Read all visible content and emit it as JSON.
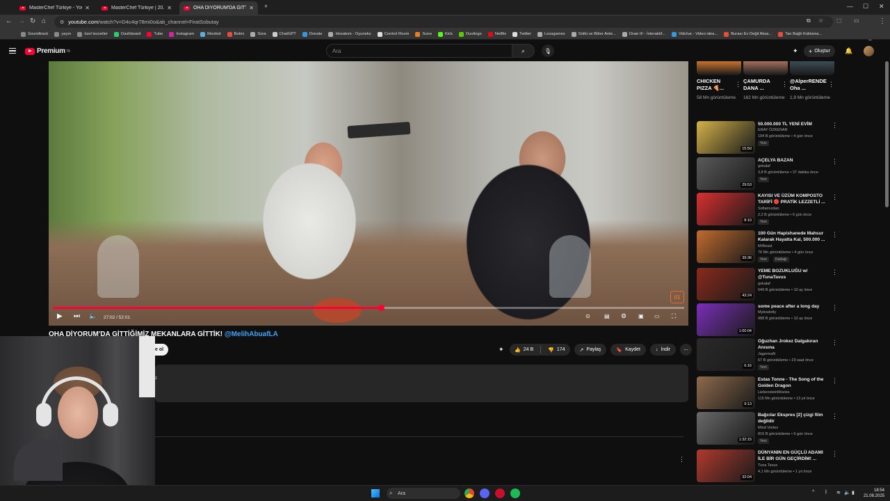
{
  "browser": {
    "tabs": [
      {
        "title": "MasterChef Türkiye - YouTube",
        "active": false
      },
      {
        "title": "MasterChef Türkiye | 20.07.2025",
        "active": false
      },
      {
        "title": "OHA DİYORUM'DA GİTTİĞİMİZ",
        "active": true
      }
    ],
    "url_host": "youtube.com",
    "url_path": "/watch?v=D4c4qr78mi0o&ab_channel=FiratSobutay",
    "bookmarks": [
      {
        "label": "Soundtrack",
        "color": "#888888"
      },
      {
        "label": "yayın",
        "color": "#888888"
      },
      {
        "label": "özel lezzetler",
        "color": "#888888"
      },
      {
        "label": "Dashboard",
        "color": "#2ecc71"
      },
      {
        "label": "Tube",
        "color": "#ff0033"
      },
      {
        "label": "Instagram",
        "color": "#d6249f"
      },
      {
        "label": "Moobot",
        "color": "#5ab0d6"
      },
      {
        "label": "Botrix",
        "color": "#e74c3c"
      },
      {
        "label": "Sora",
        "color": "#aaaaaa"
      },
      {
        "label": "ChatGPT",
        "color": "#cccccc"
      },
      {
        "label": "Donate",
        "color": "#3498db"
      },
      {
        "label": "Hesabım - Oyuneks",
        "color": "#aaaaaa"
      },
      {
        "label": "Control Room",
        "color": "#dddddd"
      },
      {
        "label": "Suno",
        "color": "#e67e22"
      },
      {
        "label": "Kick",
        "color": "#53fc18"
      },
      {
        "label": "Duolingo",
        "color": "#58cc02"
      },
      {
        "label": "Netflix",
        "color": "#e50914"
      },
      {
        "label": "Twitter",
        "color": "#dddddd"
      },
      {
        "label": "Lessgames",
        "color": "#aaaaaa"
      },
      {
        "label": "Sütlü ve Bitter Ante...",
        "color": "#aaaaaa"
      },
      {
        "label": "Draw It! - İnteraktif...",
        "color": "#aaaaaa"
      },
      {
        "label": "Vidclue - Video idea...",
        "color": "#3498db"
      },
      {
        "label": "Burası Ev Değil Aksa...",
        "color": "#e74c3c"
      },
      {
        "label": "Tan Bağlı Koklama...",
        "color": "#e74c3c"
      }
    ]
  },
  "header": {
    "brand": "Premium",
    "brand_sup": "TR",
    "search_placeholder": "Ara",
    "create_label": "Oluştur"
  },
  "player": {
    "time_label": "27:02 / 52:01",
    "progress_fraction": 0.52,
    "channel_logo": "01"
  },
  "video": {
    "title": "OHA DİYORUM'DA GİTTİĞİMİZ MEKANLARA GİTTİK!",
    "mention": "@MelihAbuafLA",
    "subscribe_fragment": "e ol",
    "like_count": "24 B",
    "dislike_count": "174",
    "share_label": "Paylaş",
    "save_label": "Kaydet",
    "download_label": "İndir",
    "desc_fragment": "z"
  },
  "shorts": [
    {
      "title": "CHICKEN PIZZA 🍕...",
      "views": "58 Mn görüntüleme",
      "color": "#c9742f"
    },
    {
      "title": "ÇAMURDA DANA ...",
      "views": "162 Mn görüntüleme",
      "color": "#a3715c"
    },
    {
      "title": "@AlperRENDE Oha ...",
      "views": "1,9 Mn görüntüleme",
      "color": "#3d4c55"
    }
  ],
  "recommendations": [
    {
      "title": "50.000.000 TL YENİ EVİM",
      "channel": "ERAY ÖZKENAR",
      "meta": "194 B görüntüleme • 4 gün önce",
      "badge": "Yeni",
      "duration": "15:50",
      "color": "#d4b24a"
    },
    {
      "title": "AÇELYA BAZAN",
      "channel": "gokalaf",
      "meta": "3,8 B görüntüleme • 37 dakika önce",
      "badge": "Yeni",
      "duration": "29:53",
      "color": "#5a5a5a"
    },
    {
      "title": "KAYISI VE ÜZÜM KOMPOSTO TARİFİ 🔴 PRATİK LEZZETLİ ...",
      "channel": "Sofiamızdan",
      "meta": "2,2 B görüntüleme • 6 gün önce",
      "badge": "Yeni",
      "duration": "8:10",
      "color": "#d93030"
    },
    {
      "title": "100 Gün Hapishanede Mahsur Kalarak Hayatta Kal, 500.000 ...",
      "channel": "MrBeast",
      "meta": "76 Mn görüntüleme • 4 gün önce",
      "badge": "Yeni",
      "badge2": "Dublajlı",
      "duration": "39:36",
      "color": "#c26b2f"
    },
    {
      "title": "YEME BOZUKLUĞU w/ @TunaTavus",
      "channel": "gokalaf",
      "meta": "549 B görüntüleme • 10 ay önce",
      "badge": "",
      "duration": "43:24",
      "color": "#8a2a1c"
    },
    {
      "title": "some peace after a long day",
      "channel": "Mylesdotty",
      "meta": "988 B görüntüleme • 10 ay önce",
      "badge": "",
      "duration": "1:00:04",
      "color": "#7a2fb8"
    },
    {
      "title": "Oğuzhan Jrokez Dalgakıran Anısına",
      "channel": "JagermaN",
      "meta": "67 B görüntüleme • 23 saat önce",
      "badge": "Yeni",
      "duration": "6:16",
      "color": "#2a2a2a"
    },
    {
      "title": "Estas Tonne - The Song of the Golden Dragon",
      "channel": "LiebensteinMovies",
      "meta": "115 Mn görüntüleme • 13 yıl önce",
      "badge": "",
      "duration": "9:13",
      "color": "#8e6a4c"
    },
    {
      "title": "Bağcılar Ekspres [2] çizgi film değildir",
      "channel": "Mind Vortex",
      "meta": "816 B görüntüleme • 5 gün önce",
      "badge": "Yeni",
      "duration": "1:32:15",
      "color": "#6a6a6a"
    },
    {
      "title": "DÜNYANIN EN GÜÇLÜ ADAMI İLE BİR GÜN GEÇİRDİM! ...",
      "channel": "Tuna Tavus",
      "meta": "4,1 Mn görüntüleme • 1 yıl önce",
      "badge": "",
      "duration": "32:04",
      "color": "#b03a2e"
    }
  ],
  "taskbar": {
    "search_placeholder": "Ara",
    "time": "18:54",
    "date": "21.08.2025"
  }
}
